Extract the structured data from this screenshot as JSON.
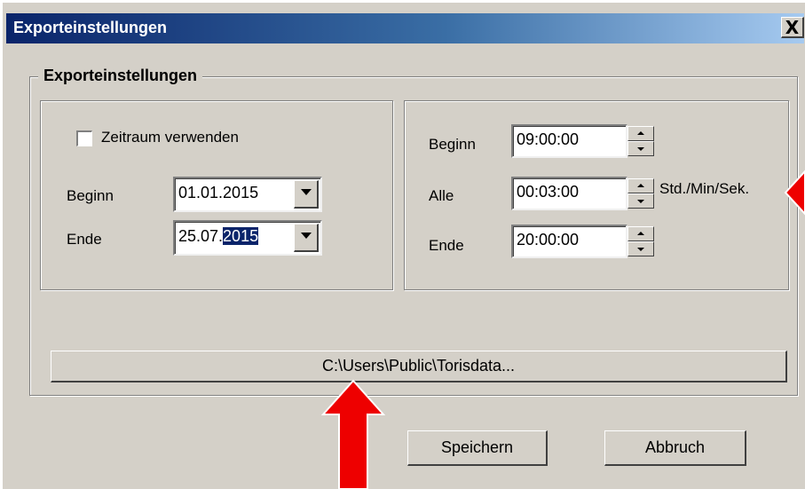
{
  "window": {
    "title": "Exporteinstellungen",
    "close_glyph": "X"
  },
  "group": {
    "title": "Exporteinstellungen"
  },
  "date_panel": {
    "checkbox_label": "Zeitraum verwenden",
    "checkbox_checked": false,
    "begin_label": "Beginn",
    "begin_value": "01.01.2015",
    "end_label": "Ende",
    "end_value_prefix": "25.07.",
    "end_value_selected": "2015"
  },
  "time_panel": {
    "begin_label": "Beginn",
    "begin_value": "09:00:00",
    "every_label": "Alle",
    "every_value": "00:03:00",
    "unit_label": "Std./Min/Sek.",
    "end_label": "Ende",
    "end_value": "20:00:00"
  },
  "path_button": {
    "label": "C:\\Users\\Public\\Torisdata..."
  },
  "actions": {
    "save_label": "Speichern",
    "cancel_label": "Abbruch"
  },
  "icons": {
    "dropdown": "chevron-down-icon",
    "spin_up": "spin-up-icon",
    "spin_down": "spin-down-icon",
    "annotation_arrow": "red-arrow-icon"
  },
  "colors": {
    "face": "#d4d0c8",
    "title_start": "#0a246a",
    "title_end": "#a6caf0",
    "selection": "#0a246a",
    "arrow": "#ee0000"
  }
}
